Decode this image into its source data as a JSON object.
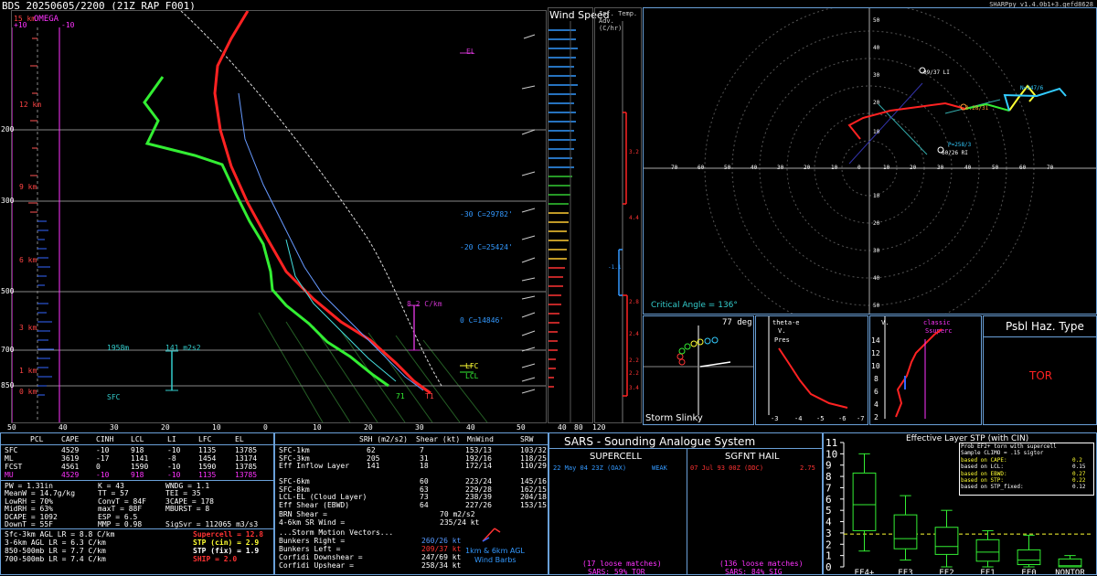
{
  "header": {
    "title": "BDS  20250605/2200  (21Z  RAP  F001)",
    "version": "SHARPpy v1.4.0b1+3.gefd8628"
  },
  "skewt": {
    "top_label": "15 km",
    "omega_label": "OMEGA",
    "omega_left": "+10",
    "omega_right": "-10",
    "height_labels": [
      "12 km",
      "9 km",
      "6 km",
      "3 km",
      "1 km",
      "0 km"
    ],
    "pressure_labels": [
      "200",
      "300",
      "500",
      "700",
      "850"
    ],
    "temp_ticks": [
      "50",
      "40",
      "30",
      "20",
      "10",
      "0",
      "10",
      "20",
      "30",
      "40",
      "50"
    ],
    "el_label": "EL",
    "lfc_label": "LFC",
    "lcl_label": "LCL",
    "isotherm_labels": [
      "-30 C=29782'",
      "-20 C=25424'",
      "0 C=14846'"
    ],
    "lapse_label": "8.2 C/km",
    "eil_bottom": "1958m",
    "eil_srh": "141 m2s2",
    "sfc_label": "SFC",
    "sfc_temp": "71",
    "sfc_dew": "T1"
  },
  "wind_speed": {
    "title": "Wind Speed",
    "ticks": [
      "40",
      "80",
      "120"
    ]
  },
  "temp_adv": {
    "title": "Inf. Temp. Adv. (C/hr)",
    "values": [
      "3.2",
      "4.4",
      "-1.1",
      "2.8",
      "2.4",
      "2.2",
      "2.2",
      "3.4"
    ]
  },
  "hodograph": {
    "x_ticks": [
      "70",
      "60",
      "50",
      "40",
      "30",
      "20",
      "10",
      "0",
      "10",
      "20",
      "30",
      "40",
      "50",
      "60",
      "70"
    ],
    "y_ticks": [
      "50",
      "40",
      "30",
      "20",
      "10",
      "10",
      "20",
      "30",
      "40",
      "50"
    ],
    "annotations": [
      "09/37 LI",
      "0.28/31",
      "N=247/6",
      "P=258/3",
      "60/26 RI"
    ],
    "critical_angle": "Critical Angle = 136°"
  },
  "storm_slinky": {
    "title": "Storm Slinky",
    "angle": "77 deg"
  },
  "theta_panel": {
    "labels": [
      "theta-e",
      "V.",
      "Pres"
    ],
    "ticks": [
      "-3",
      "-4",
      "-5",
      "-6",
      "-7"
    ]
  },
  "vrot_panel": {
    "labels": [
      "V.",
      "classic",
      "Ssuperc"
    ],
    "y_ticks": [
      "14",
      "12",
      "10",
      "8",
      "6",
      "4",
      "2"
    ]
  },
  "hazard": {
    "title": "Psbl Haz. Type",
    "value": "TOR"
  },
  "thermo": {
    "headers": [
      "PCL",
      "CAPE",
      "CINH",
      "LCL",
      "LI",
      "LFC",
      "EL"
    ],
    "rows": [
      {
        "name": "SFC",
        "cape": "4529",
        "cinh": "-10",
        "lcl": "918",
        "li": "-10",
        "lfc": "1135",
        "el": "13785",
        "color": "#ffffff"
      },
      {
        "name": "ML",
        "cape": "3619",
        "cinh": "-17",
        "lcl": "1141",
        "li": "-8",
        "lfc": "1454",
        "el": "13174",
        "color": "#ffffff"
      },
      {
        "name": "FCST",
        "cape": "4561",
        "cinh": "0",
        "lcl": "1590",
        "li": "-10",
        "lfc": "1590",
        "el": "13785",
        "color": "#ffffff"
      },
      {
        "name": "MU",
        "cape": "4529",
        "cinh": "-10",
        "lcl": "918",
        "li": "-10",
        "lfc": "1135",
        "el": "13785",
        "color": "#ff33ff"
      }
    ],
    "indices_col1": [
      "PW = 1.31in",
      "MeanW = 14.7g/kg",
      "LowRH = 70%",
      "MidRH = 63%",
      "DCAPE = 1092",
      "DownT = 55F"
    ],
    "indices_col2": [
      "K = 43",
      "TT = 57",
      "ConvT = 84F",
      "maxT = 88F",
      "ESP = 6.5",
      "MMP = 0.98"
    ],
    "indices_col3": [
      "WNDG = 1.1",
      "TEI = 35",
      "3CAPE = 178",
      "MBURST = 8",
      "",
      "SigSvr = 112065 m3/s3"
    ],
    "lapse_rates": [
      "Sfc-3km AGL LR = 8.8 C/km",
      "3-6km AGL LR = 6.3 C/km",
      "850-500mb LR = 7.7 C/km",
      "700-500mb LR = 7.4 C/km"
    ],
    "composites": [
      {
        "label": "Supercell = 12.8",
        "color": "#ff3333"
      },
      {
        "label": "STP (cin) = 2.9",
        "color": "#ffff33"
      },
      {
        "label": "STP (fix) = 1.9",
        "color": "#ffffff"
      },
      {
        "label": "SHIP = 2.0",
        "color": "#ff3333"
      }
    ]
  },
  "kinematics": {
    "headers": [
      "SRH (m2/s2)",
      "Shear (kt)",
      "MnWind",
      "SRW"
    ],
    "rows": [
      {
        "name": "SFC-1km",
        "srh": "62",
        "shear": "7",
        "mnwind": "153/13",
        "srw": "103/32"
      },
      {
        "name": "SFC-3km",
        "srh": "205",
        "shear": "31",
        "mnwind": "192/16",
        "srw": "118/25"
      },
      {
        "name": "Eff Inflow Layer",
        "srh": "141",
        "shear": "18",
        "mnwind": "172/14",
        "srw": "110/29"
      },
      {
        "name": "",
        "srh": "",
        "shear": "",
        "mnwind": "",
        "srw": ""
      },
      {
        "name": "SFC-6km",
        "srh": "",
        "shear": "60",
        "mnwind": "223/24",
        "srw": "145/16"
      },
      {
        "name": "SFC-8km",
        "srh": "",
        "shear": "63",
        "mnwind": "229/28",
        "srw": "162/15"
      },
      {
        "name": "LCL-EL (Cloud Layer)",
        "srh": "",
        "shear": "73",
        "mnwind": "238/39",
        "srw": "204/18"
      },
      {
        "name": "Eff Shear (EBWD)",
        "srh": "",
        "shear": "64",
        "mnwind": "227/26",
        "srw": "153/15"
      }
    ],
    "brn": "BRN Shear =",
    "brn_val": "70 m2/s2",
    "sr_wind": "4-6km SR Wind =",
    "sr_wind_val": "235/24 kt",
    "smv_title": "...Storm Motion Vectors...",
    "smv": [
      {
        "name": "Bunkers Right =",
        "val": "260/26 kt",
        "color": "#5599ff"
      },
      {
        "name": "Bunkers Left =",
        "val": "209/37 kt",
        "color": "#ff3333"
      },
      {
        "name": "Corfidi Downshear =",
        "val": "247/69 kt",
        "color": "#ffffff"
      },
      {
        "name": "Corfidi Upshear =",
        "val": "258/34 kt",
        "color": "#ffffff"
      }
    ],
    "barb_label_1": "1km & 6km AGL",
    "barb_label_2": "Wind Barbs"
  },
  "sars": {
    "title": "SARS - Sounding Analogue System",
    "supercell_title": "SUPERCELL",
    "supercell_match": "22 May 04 23Z (OAX)",
    "supercell_match_val": "WEAK",
    "hail_title": "SGFNT HAIL",
    "hail_match": "07 Jul 93 00Z (DDC)",
    "hail_match_val": "2.75",
    "supercell_loose": "(17 loose matches)",
    "supercell_pct": "SARS: 59% TOR",
    "hail_loose": "(136 loose matches)",
    "hail_pct": "SARS: 84% SIG"
  },
  "stp": {
    "title": "Effective Layer STP (with CIN)",
    "legend": [
      {
        "label": "Prob EF2+ torn with supercell",
        "val": "",
        "color": "#ffffff"
      },
      {
        "label": "Sample CLIMO = .15 sigtor",
        "val": "",
        "color": "#ffffff"
      },
      {
        "label": "based on CAPE:",
        "val": "0.2",
        "color": "#ffff33"
      },
      {
        "label": "based on LCL:",
        "val": "0.15",
        "color": "#ffffff"
      },
      {
        "label": "based on EBWD:",
        "val": "0.27",
        "color": "#ffff33"
      },
      {
        "label": "based on STP:",
        "val": "0.22",
        "color": "#ffff33"
      },
      {
        "label": "based on STP_fixed:",
        "val": "0.12",
        "color": "#ffffff"
      }
    ],
    "y_ticks": [
      "11",
      "10",
      "9",
      "8",
      "7",
      "6",
      "5",
      "4",
      "3",
      "2",
      "1",
      "0"
    ],
    "categories": [
      "EF4+",
      "EF3",
      "EF2",
      "EF1",
      "EF0",
      "NONTOR"
    ]
  },
  "chart_data": [
    {
      "type": "box",
      "title": "Effective Layer STP (with CIN)",
      "categories": [
        "EF4+",
        "EF3",
        "EF2",
        "EF1",
        "EF0",
        "NONTOR"
      ],
      "boxes": [
        {
          "whisker_low": 1.4,
          "q1": 3.2,
          "median": 5.5,
          "q3": 8.3,
          "whisker_high": 10.0
        },
        {
          "whisker_low": 0.6,
          "q1": 1.6,
          "median": 2.5,
          "q3": 4.6,
          "whisker_high": 6.3
        },
        {
          "whisker_low": 0.0,
          "q1": 1.1,
          "median": 1.8,
          "q3": 3.5,
          "whisker_high": 5.0
        },
        {
          "whisker_low": 0.0,
          "q1": 0.5,
          "median": 1.3,
          "q3": 2.4,
          "whisker_high": 3.2
        },
        {
          "whisker_low": 0.0,
          "q1": 0.2,
          "median": 0.6,
          "q3": 1.5,
          "whisker_high": 2.8
        },
        {
          "whisker_low": 0.0,
          "q1": 0.0,
          "median": 0.1,
          "q3": 0.7,
          "whisker_high": 1.0
        }
      ],
      "current_stp": 2.9,
      "ylim": [
        0,
        11
      ]
    }
  ]
}
